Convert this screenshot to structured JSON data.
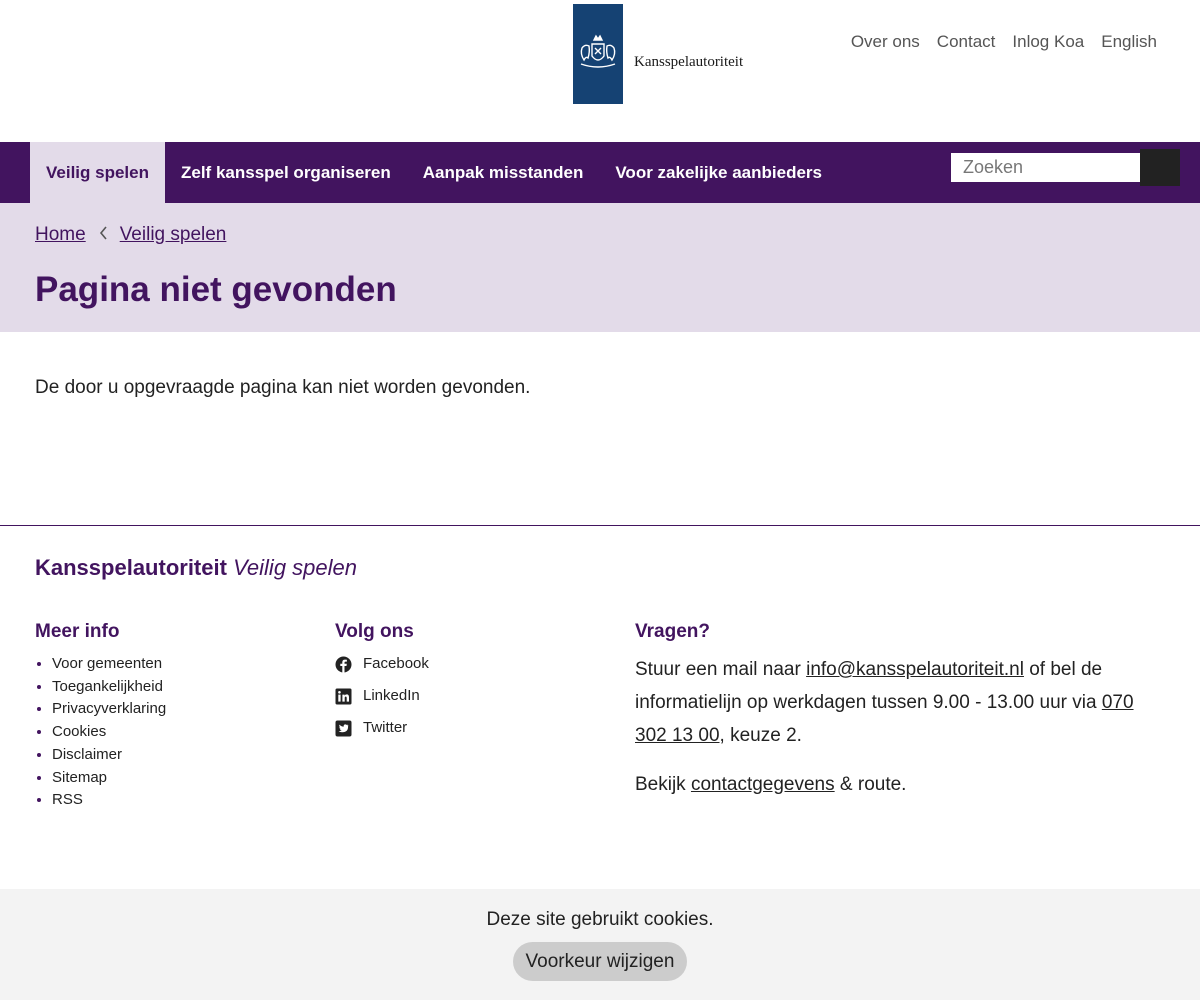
{
  "header": {
    "logo_text": "Kansspelautoriteit",
    "service_nav": [
      "Over ons",
      "Contact",
      "Inlog Koa",
      "English"
    ]
  },
  "mainnav": {
    "items": [
      "Veilig spelen",
      "Zelf kansspel organiseren",
      "Aanpak misstanden",
      "Voor zakelijke aanbieders"
    ],
    "active": "Veilig spelen"
  },
  "search": {
    "placeholder": "Zoeken"
  },
  "breadcrumb": {
    "home": "Home",
    "current": "Veilig spelen"
  },
  "page": {
    "title": "Pagina niet gevonden",
    "message": "De door u opgevraagde pagina kan niet worden gevonden."
  },
  "footer": {
    "brand_name": "Kansspelautoriteit",
    "brand_section": "Veilig spelen",
    "meer_info": {
      "heading": "Meer info",
      "links": [
        "Voor gemeenten",
        "Toegankelijkheid",
        "Privacyverklaring",
        "Cookies",
        "Disclaimer",
        "Sitemap",
        "RSS"
      ]
    },
    "volg_ons": {
      "heading": "Volg ons",
      "links": [
        {
          "label": "Facebook",
          "icon": "facebook-icon"
        },
        {
          "label": "LinkedIn",
          "icon": "linkedin-icon"
        },
        {
          "label": "Twitter",
          "icon": "twitter-icon"
        }
      ]
    },
    "vragen": {
      "heading": "Vragen?",
      "text_before_email": "Stuur een mail naar ",
      "email": "info@kansspelautoriteit.nl",
      "text_after_email": " of bel de informatielijn op werkdagen tussen 9.00 - 13.00 uur via ",
      "phone": "070 302 13 00",
      "text_after_phone": ", keuze 2.",
      "route_before": "Bekijk ",
      "route_link": "contactgegevens",
      "route_after": " & route."
    }
  },
  "cookiebar": {
    "text": "Deze site gebruikt cookies.",
    "button": "Voorkeur wijzigen"
  },
  "colors": {
    "brand_purple": "#42145f",
    "light_purple": "#e3dbe9",
    "logo_blue": "#154273"
  }
}
